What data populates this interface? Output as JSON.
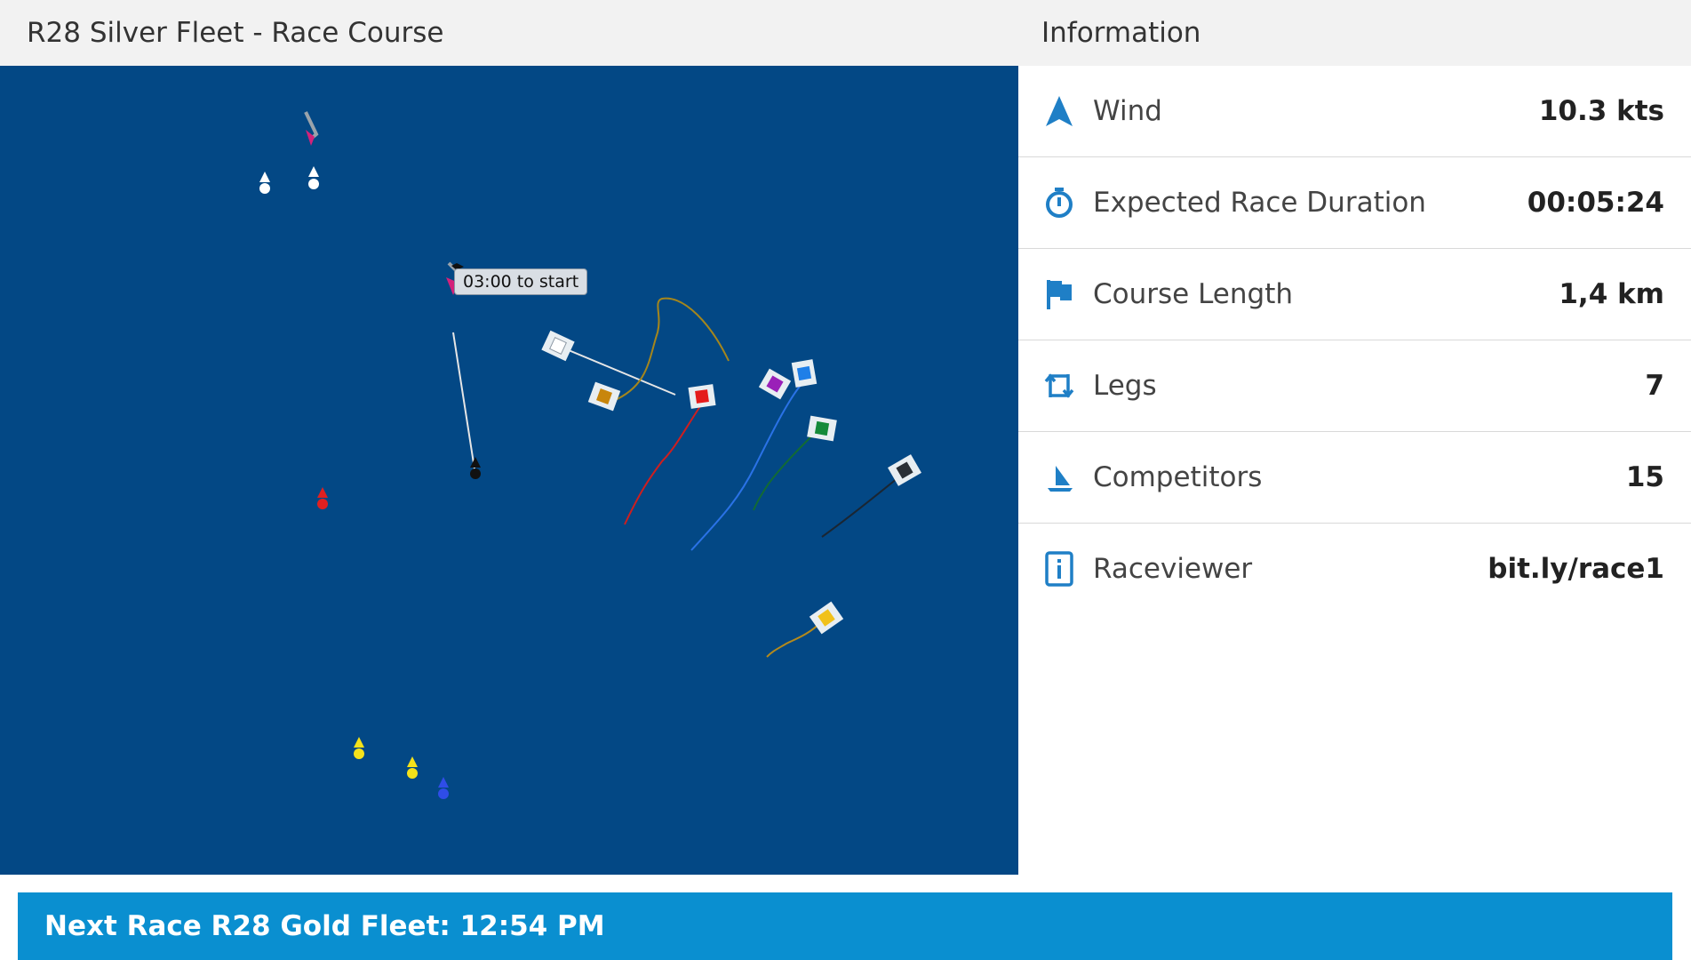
{
  "header": {
    "race_title": "R28 Silver Fleet - Race Course",
    "info_title": "Information"
  },
  "map": {
    "start_tooltip": "03:00 to start",
    "colors": {
      "water": "#034885",
      "boat_hull": "#e8eef2",
      "track_red": "#d21f1f",
      "track_blue": "#1f6fe0",
      "track_green": "#157a3a",
      "track_dark": "#1b2b3a",
      "track_gold": "#b48a1c"
    }
  },
  "info": {
    "rows": [
      {
        "icon": "wind-arrow-icon",
        "label": "Wind",
        "value": "10.3 kts"
      },
      {
        "icon": "stopwatch-icon",
        "label": "Expected Race Duration",
        "value": "00:05:24"
      },
      {
        "icon": "flag-icon",
        "label": "Course Length",
        "value": "1,4 km"
      },
      {
        "icon": "legs-arrows-icon",
        "label": "Legs",
        "value": "7"
      },
      {
        "icon": "sailboat-icon",
        "label": "Competitors",
        "value": "15"
      },
      {
        "icon": "info-icon",
        "label": "Raceviewer",
        "value": "bit.ly/race1"
      }
    ]
  },
  "footer": {
    "next_race": "Next Race R28 Gold Fleet: 12:54 PM"
  },
  "accent_color": "#1f7fc6",
  "footer_color": "#0a8fd0"
}
